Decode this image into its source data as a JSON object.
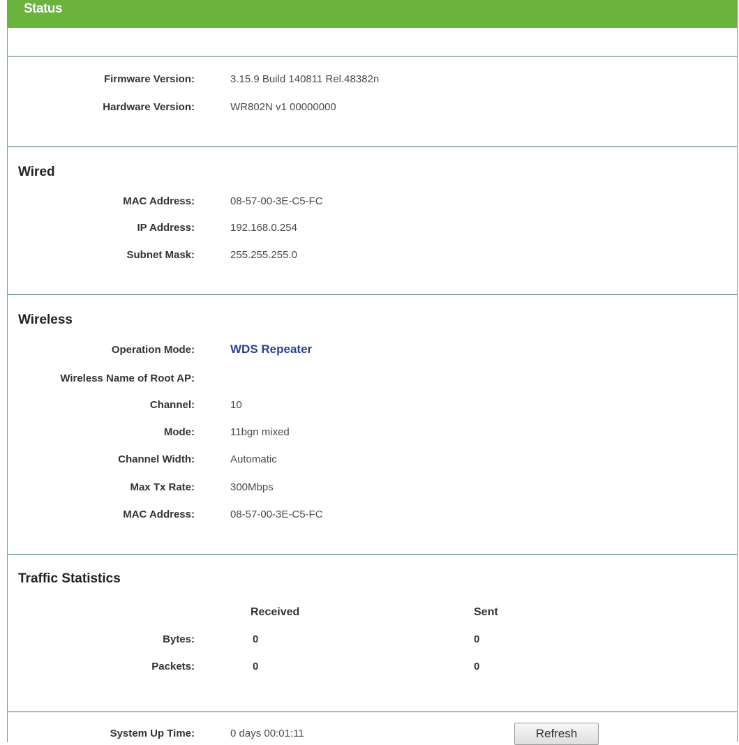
{
  "header": {
    "title": "Status"
  },
  "firmware": {
    "label": "Firmware Version:",
    "value": "3.15.9 Build 140811 Rel.48382n"
  },
  "hardware": {
    "label": "Hardware Version:",
    "value": "WR802N v1 00000000"
  },
  "wired": {
    "title": "Wired",
    "mac": {
      "label": "MAC Address:",
      "value": "08-57-00-3E-C5-FC"
    },
    "ip": {
      "label": "IP Address:",
      "value": "192.168.0.254"
    },
    "subnet": {
      "label": "Subnet Mask:",
      "value": "255.255.255.0"
    }
  },
  "wireless": {
    "title": "Wireless",
    "operation_mode": {
      "label": "Operation Mode:",
      "value": "WDS Repeater"
    },
    "root_ap": {
      "label": "Wireless Name of Root AP:",
      "value": ""
    },
    "channel": {
      "label": "Channel:",
      "value": "10"
    },
    "mode": {
      "label": "Mode:",
      "value": "11bgn mixed"
    },
    "channel_width": {
      "label": "Channel Width:",
      "value": "Automatic"
    },
    "max_tx_rate": {
      "label": "Max Tx Rate:",
      "value": "300Mbps"
    },
    "mac": {
      "label": "MAC Address:",
      "value": "08-57-00-3E-C5-FC"
    }
  },
  "traffic": {
    "title": "Traffic Statistics",
    "col_received": "Received",
    "col_sent": "Sent",
    "bytes": {
      "label": "Bytes:",
      "received": "0",
      "sent": "0"
    },
    "packets": {
      "label": "Packets:",
      "received": "0",
      "sent": "0"
    }
  },
  "uptime": {
    "label": "System Up Time:",
    "value": "0 days 00:01:11"
  },
  "refresh_label": "Refresh",
  "colors": {
    "header_green": "#6ab43e",
    "divider": "#3e7a5f",
    "link_blue": "#24419a"
  }
}
